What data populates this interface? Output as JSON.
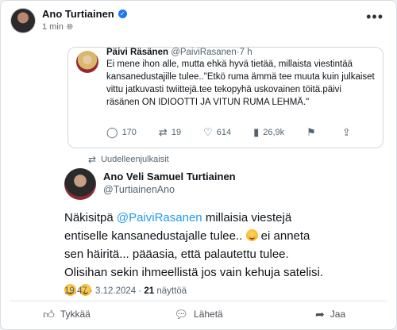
{
  "post": {
    "author": "Ano Turtiainen",
    "time": "1 min",
    "more": "•••"
  },
  "quote": {
    "name": "Päivi Räsänen",
    "handle": "@PaiviRasanen",
    "age": "7 h",
    "text": "Ei mene ihon alle, mutta ehkä hyvä tietää, millaista viestintää kansanedustajille tulee..\"Etkö ruma ämmä tee muuta kuin julkaiset vittu jatkuvasti twiittejä.tee tekopyhä uskovainen töitä.päivi räsänen ON IDIOOTTI JA VITUN RUMA LEHMÄ.\"",
    "replies": "170",
    "retweets": "19",
    "likes": "614",
    "views": "26,9k"
  },
  "retweet_label": "Uudelleenjulkaisit",
  "tweet": {
    "author_name": "Ano Veli Samuel Turtiainen",
    "author_handle": "@TurtiainenAno",
    "text_1": "Näkisitpä ",
    "mention": "@PaiviRasanen",
    "text_2": " millaisia viestejä entiselle kansanedustajalle tulee.. ",
    "text_3": " ei anneta sen häiritä... pääasia, että palautettu tulee. Olisihan sekin ihmeellistä jos vain kehuja satelisi. ",
    "timestamp": "19.47 · 3.12.2024 · ",
    "views_count": "21",
    "views_label": " näyttöä"
  },
  "actions": {
    "like": "Tykkää",
    "send": "Lähetä",
    "share": "Jaa"
  },
  "colors": {
    "link": "#1d9bf0",
    "verified": "#1877f2"
  }
}
